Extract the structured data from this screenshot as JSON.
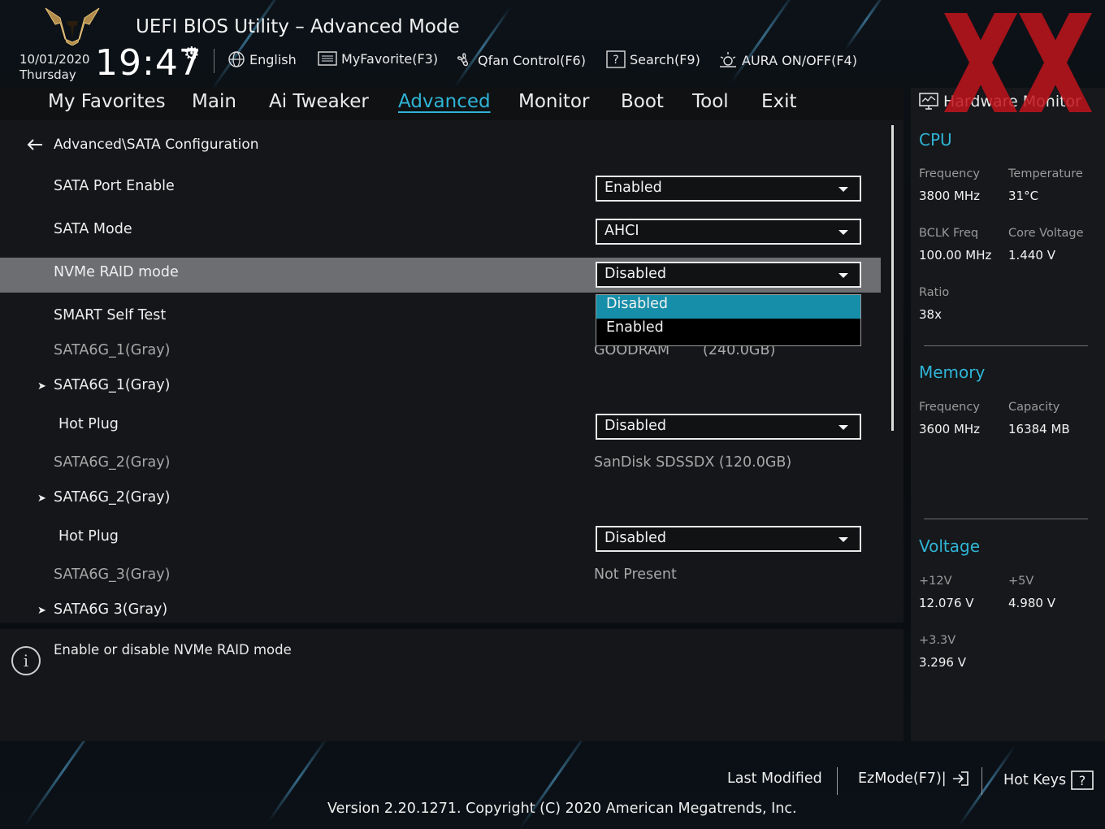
{
  "header": {
    "title": "UEFI BIOS Utility – Advanced Mode",
    "date": "10/01/2020",
    "day": "Thursday",
    "time": "19:47",
    "tools": {
      "language": "English",
      "favorite": "MyFavorite(F3)",
      "qfan": "Qfan Control(F6)",
      "search": "Search(F9)",
      "aura": "AURA ON/OFF(F4)"
    }
  },
  "nav": {
    "tabs": [
      "My Favorites",
      "Main",
      "Ai Tweaker",
      "Advanced",
      "Monitor",
      "Boot",
      "Tool",
      "Exit"
    ],
    "active": "Advanced"
  },
  "main": {
    "breadcrumb": "Advanced\\SATA Configuration",
    "rows": {
      "sata_port_enable": {
        "label": "SATA Port Enable",
        "value": "Enabled"
      },
      "sata_mode": {
        "label": "SATA Mode",
        "value": "AHCI"
      },
      "nvme_raid": {
        "label": "NVMe RAID mode",
        "value": "Disabled"
      },
      "smart": {
        "label": "SMART Self Test"
      },
      "sata1_info": {
        "label": "SATA6G_1(Gray)",
        "value_name": "GOODRAM",
        "value_size": "(240.0GB)"
      },
      "sata1_sub": {
        "label": "SATA6G_1(Gray)"
      },
      "hotplug1": {
        "label": "Hot Plug",
        "value": "Disabled"
      },
      "sata2_info": {
        "label": "SATA6G_2(Gray)",
        "value": "SanDisk SDSSDX (120.0GB)"
      },
      "sata2_sub": {
        "label": "SATA6G_2(Gray)"
      },
      "hotplug2": {
        "label": "Hot Plug",
        "value": "Disabled"
      },
      "sata3_info": {
        "label": "SATA6G_3(Gray)",
        "value": "Not Present"
      },
      "sata3_sub": {
        "label": "SATA6G 3(Gray)"
      }
    },
    "popup_options": [
      "Disabled",
      "Enabled"
    ],
    "popup_selected": "Disabled"
  },
  "help": {
    "text": "Enable or disable NVMe RAID mode"
  },
  "hardware_monitor": {
    "title": "Hardware Monitor",
    "cpu": {
      "heading": "CPU",
      "frequency_label": "Frequency",
      "frequency": "3800 MHz",
      "temperature_label": "Temperature",
      "temperature": "31°C",
      "bclk_label": "BCLK Freq",
      "bclk": "100.00 MHz",
      "core_voltage_label": "Core Voltage",
      "core_voltage": "1.440 V",
      "ratio_label": "Ratio",
      "ratio": "38x"
    },
    "memory": {
      "heading": "Memory",
      "frequency_label": "Frequency",
      "frequency": "3600 MHz",
      "capacity_label": "Capacity",
      "capacity": "16384 MB"
    },
    "voltage": {
      "heading": "Voltage",
      "v12_label": "+12V",
      "v12": "12.076 V",
      "v5_label": "+5V",
      "v5": "4.980 V",
      "v33_label": "+3.3V",
      "v33": "3.296 V"
    }
  },
  "footer": {
    "last_modified": "Last Modified",
    "ezmode": "EzMode(F7)|",
    "hotkeys": "Hot Keys",
    "version": "Version 2.20.1271. Copyright (C) 2020 American Megatrends, Inc."
  },
  "colors": {
    "accent": "#2fb4d6",
    "selected_option": "#168ea9",
    "highlight_row": "#6c6e71",
    "watermark": "#c0141c"
  }
}
